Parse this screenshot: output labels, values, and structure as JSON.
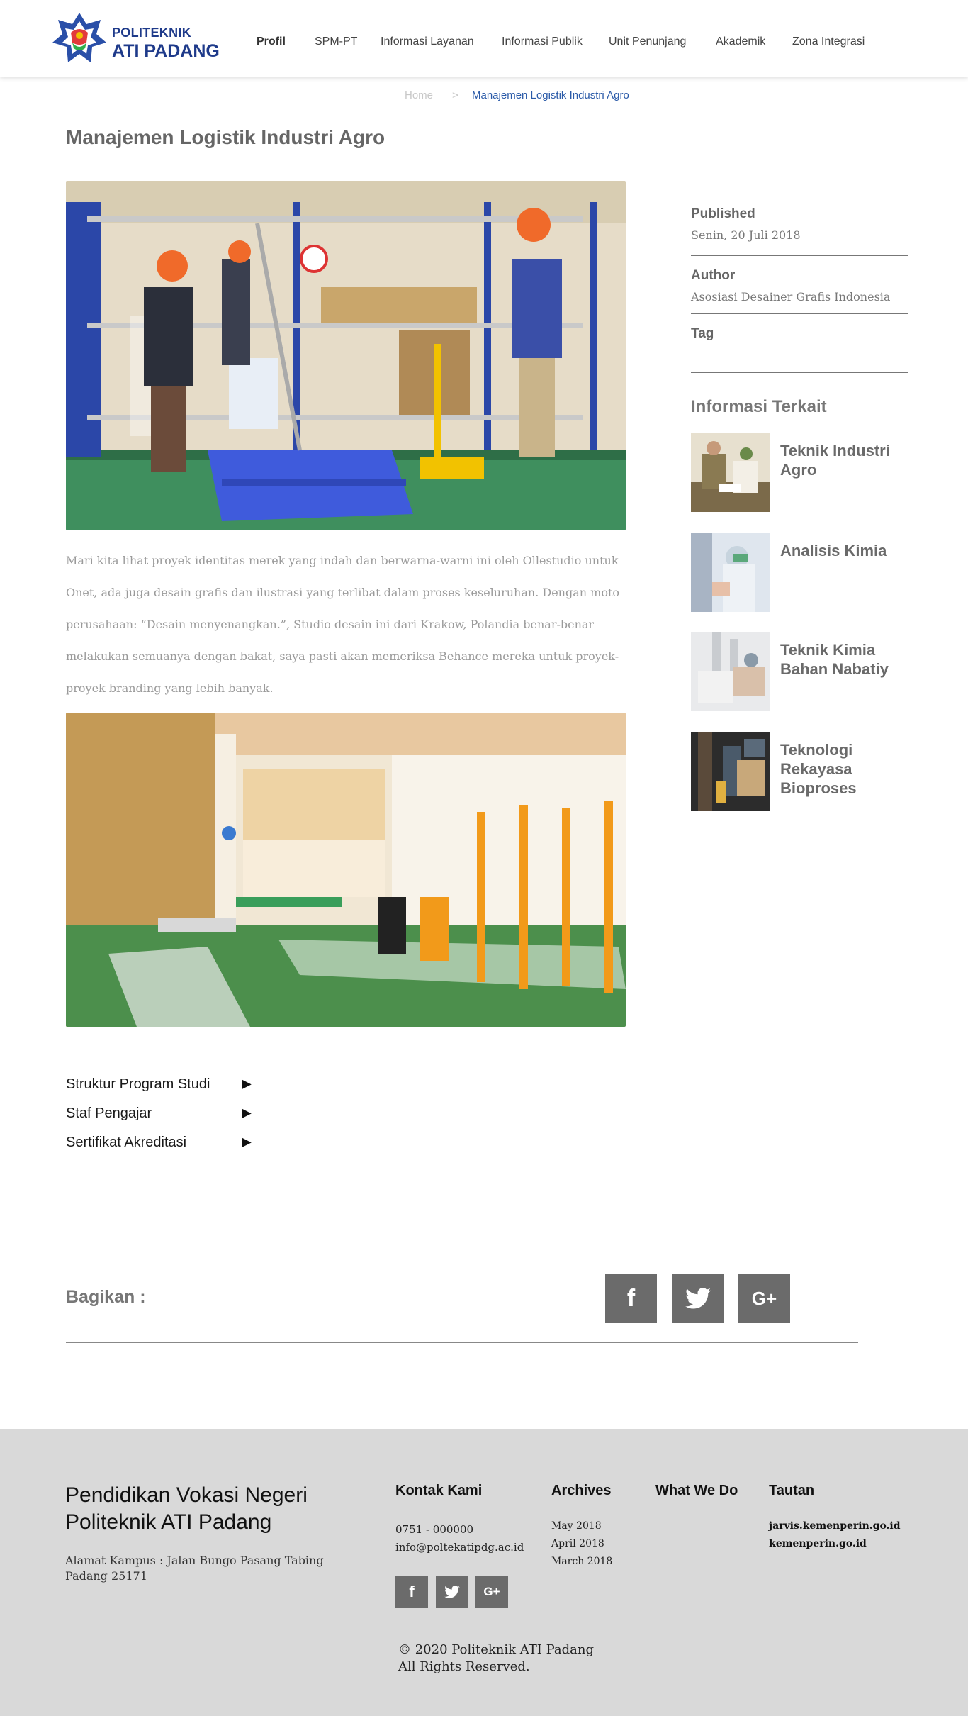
{
  "brand": {
    "line1": "POLITEKNIK",
    "line2": "ATI PADANG",
    "color": "#1e3a8a"
  },
  "nav": {
    "items": [
      "Profil",
      "SPM-PT",
      "Informasi Layanan",
      "Informasi Publik",
      "Unit Penunjang",
      "Akademik",
      "Zona Integrasi"
    ],
    "active": "Profil"
  },
  "breadcrumb": {
    "home": "Home",
    "separator": ">",
    "current": "Manajemen Logistik Industri Agro"
  },
  "article": {
    "title": "Manajemen Logistik Industri Agro",
    "body": "Mari kita lihat proyek identitas merek yang indah dan berwarna-warni ini oleh Ollestudio untuk Onet, ada juga desain grafis dan ilustrasi yang terlibat dalam proses keseluruhan. Dengan moto perusahaan: “Desain menyenangkan.”, Studio desain ini dari Krakow, Polandia benar-benar melakukan semuanya dengan bakat, saya pasti akan memeriksa Behance mereka untuk proyek-proyek branding yang lebih banyak."
  },
  "links": [
    {
      "label": "Struktur Program Studi",
      "arrow": "▶"
    },
    {
      "label": "Staf Pengajar",
      "arrow": "▶"
    },
    {
      "label": "Sertifikat Akreditasi",
      "arrow": "▶"
    }
  ],
  "share": {
    "label": "Bagikan :",
    "buttons": [
      {
        "name": "facebook",
        "glyph": "f"
      },
      {
        "name": "twitter",
        "glyph": "🐦"
      },
      {
        "name": "google-plus",
        "glyph": "G+"
      }
    ]
  },
  "sidebar": {
    "published_label": "Published",
    "published_value": "Senin, 20 Juli 2018",
    "author_label": "Author",
    "author_value": "Asosiasi Desainer Grafis Indonesia",
    "tag_label": "Tag",
    "related_heading": "Informasi Terkait",
    "related": [
      {
        "title": "Teknik Industri Agro"
      },
      {
        "title": "Analisis Kimia"
      },
      {
        "title": "Teknik Kimia Bahan Nabatiy"
      },
      {
        "title": "Teknologi Rekayasa Bioproses"
      }
    ]
  },
  "footer": {
    "title": "Pendidikan Vokasi Negeri Politeknik ATI Padang",
    "address": "Alamat Kampus : Jalan Bungo Pasang Tabing Padang 25171",
    "contact_heading": "Kontak Kami",
    "phone": "0751 - 000000",
    "email": "info@poltekatipdg.ac.id",
    "archives_heading": "Archives",
    "archives": [
      "May 2018",
      "April 2018",
      "March 2018"
    ],
    "whatwedo_heading": "What We Do",
    "tautan_heading": "Tautan",
    "tautan": [
      "jarvis.kemenperin.go.id",
      "kemenperin.go.id"
    ],
    "social": [
      "f",
      "🐦",
      "G+"
    ],
    "copyright_line1": "© 2020 Politeknik ATI Padang",
    "copyright_line2": "All Rights Reserved."
  }
}
